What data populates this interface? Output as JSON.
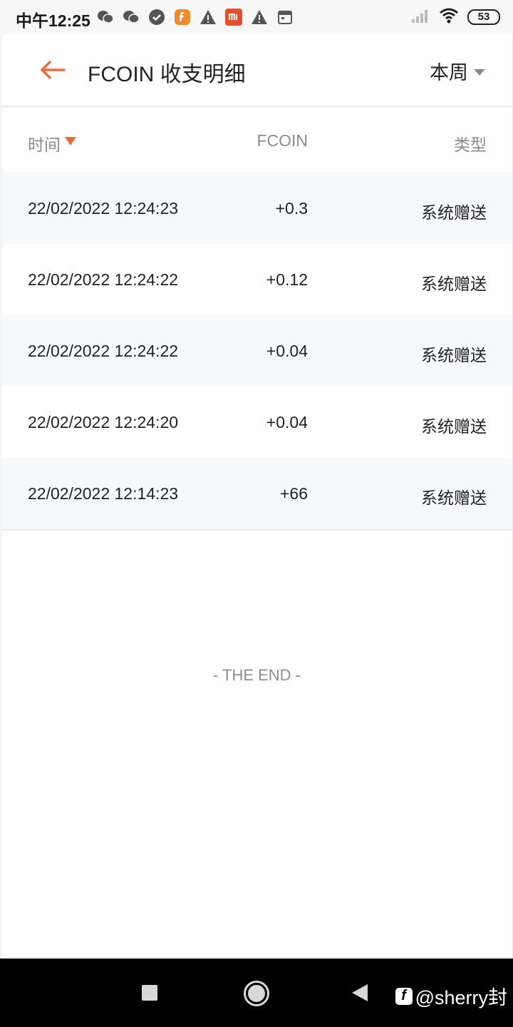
{
  "status_bar": {
    "time": "中午12:25",
    "battery": "53",
    "icons": [
      "wechat-icon",
      "wechat-icon",
      "check-circle-icon",
      "fcoin-app-icon",
      "warning-icon",
      "mi-icon",
      "warning-icon",
      "calendar-icon"
    ]
  },
  "header": {
    "title": "FCOIN 收支明细",
    "period": "本周"
  },
  "table": {
    "columns": {
      "time": "时间",
      "fcoin": "FCOIN",
      "type": "类型"
    },
    "rows": [
      {
        "time": "22/02/2022 12:24:23",
        "amount": "+0.3",
        "type": "系统赠送"
      },
      {
        "time": "22/02/2022 12:24:22",
        "amount": "+0.12",
        "type": "系统赠送"
      },
      {
        "time": "22/02/2022 12:24:22",
        "amount": "+0.04",
        "type": "系统赠送"
      },
      {
        "time": "22/02/2022 12:24:20",
        "amount": "+0.04",
        "type": "系统赠送"
      },
      {
        "time": "22/02/2022 12:14:23",
        "amount": "+66",
        "type": "系统赠送"
      }
    ]
  },
  "footer": {
    "end_text": "- THE END -"
  },
  "watermark": {
    "text": "@sherry封"
  },
  "colors": {
    "accent": "#ee6b3b",
    "row_shade": "#f8f9fb",
    "muted_text": "#8b8b8b"
  }
}
